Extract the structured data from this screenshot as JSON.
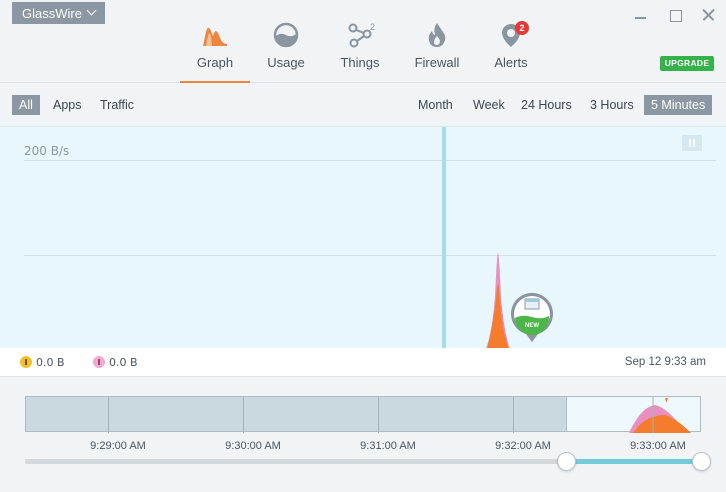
{
  "app": {
    "name": "GlassWire"
  },
  "nav": {
    "tabs": [
      {
        "label": "Graph",
        "icon": "graph-icon",
        "active": true
      },
      {
        "label": "Usage",
        "icon": "usage-icon"
      },
      {
        "label": "Things",
        "icon": "things-icon",
        "count": "2"
      },
      {
        "label": "Firewall",
        "icon": "firewall-icon"
      },
      {
        "label": "Alerts",
        "icon": "alerts-icon",
        "badge": "2"
      }
    ],
    "upgrade_label": "UPGRADE"
  },
  "filters": {
    "views": [
      {
        "label": "All",
        "selected": true
      },
      {
        "label": "Apps"
      },
      {
        "label": "Traffic"
      }
    ],
    "ranges": [
      {
        "label": "Month"
      },
      {
        "label": "Week"
      },
      {
        "label": "24 Hours"
      },
      {
        "label": "3 Hours"
      },
      {
        "label": "5 Minutes",
        "selected": true
      }
    ]
  },
  "graph": {
    "scale_label": "200 B/s",
    "new_badge": "NEW",
    "download": "0.0 B",
    "upload": "0.0 B",
    "timestamp": "Sep 12 9:33 am"
  },
  "timeline": {
    "labels": [
      "9:29:00 AM",
      "9:30:00 AM",
      "9:31:00 AM",
      "9:32:00 AM",
      "9:33:00 AM"
    ]
  },
  "colors": {
    "accent": "#ee8640",
    "download": "#f1bf2c",
    "upload": "#f3a8cf",
    "incoming_area": "#f47c2c",
    "outgoing_area": "#e88fbf",
    "upgrade": "#36b24a"
  }
}
